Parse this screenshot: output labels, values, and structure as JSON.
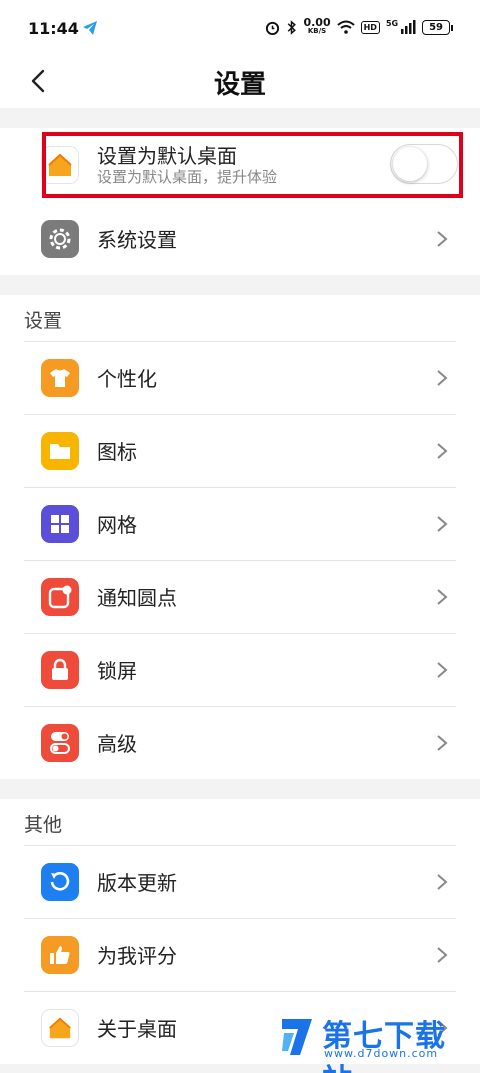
{
  "status_bar": {
    "time": "11:44",
    "speed_value": "0.00",
    "speed_unit": "KB/S",
    "hd": "HD",
    "network": "5G",
    "battery": "59"
  },
  "header": {
    "title": "设置"
  },
  "default_launcher": {
    "title": "设置为默认桌面",
    "subtitle": "设置为默认桌面，提升体验",
    "enabled": false
  },
  "system_settings": {
    "label": "系统设置"
  },
  "settings_section": {
    "title": "设置",
    "items": [
      {
        "label": "个性化",
        "icon": "tshirt-icon",
        "color": "#f59a23"
      },
      {
        "label": "图标",
        "icon": "folder-icon",
        "color": "#f7b500"
      },
      {
        "label": "网格",
        "icon": "grid-icon",
        "color": "#5b4fd9"
      },
      {
        "label": "通知圆点",
        "icon": "notification-dot-icon",
        "color": "#ee4b3b"
      },
      {
        "label": "锁屏",
        "icon": "lock-icon",
        "color": "#ee4b3b"
      },
      {
        "label": "高级",
        "icon": "toggles-icon",
        "color": "#ee4b3b"
      }
    ]
  },
  "other_section": {
    "title": "其他",
    "items": [
      {
        "label": "版本更新",
        "icon": "refresh-icon",
        "color": "#1e7ff0"
      },
      {
        "label": "为我评分",
        "icon": "thumbs-up-icon",
        "color": "#f59a23"
      },
      {
        "label": "关于桌面",
        "icon": "home-icon",
        "color": "#ffffff"
      }
    ]
  },
  "watermark": {
    "title": "第七下载站",
    "url": "www.d7down.com"
  },
  "colors": {
    "highlight": "#e0001b",
    "background": "#f3f3f3"
  }
}
